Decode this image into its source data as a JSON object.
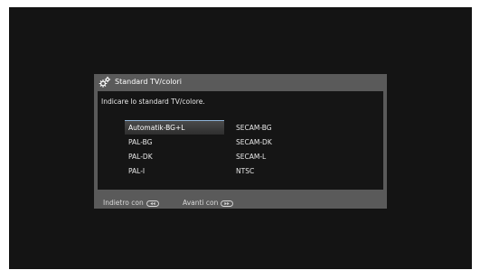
{
  "dialog": {
    "title": "Standard TV/colori",
    "title_icon": "gears-icon",
    "instruction": "Indicare lo standard TV/colore.",
    "options": [
      {
        "label": "Automatik-BG+L",
        "selected": true
      },
      {
        "label": "PAL-BG",
        "selected": false
      },
      {
        "label": "PAL-DK",
        "selected": false
      },
      {
        "label": "PAL-I",
        "selected": false
      },
      {
        "label": "SECAM-BG",
        "selected": false
      },
      {
        "label": "SECAM-DK",
        "selected": false
      },
      {
        "label": "SECAM-L",
        "selected": false
      },
      {
        "label": "NTSC",
        "selected": false
      }
    ],
    "footer": {
      "back_label": "Indietro con",
      "back_icon": "rewind-key-icon",
      "forward_label": "Avanti con",
      "forward_icon": "fast-forward-key-icon"
    }
  },
  "colors": {
    "screen_bg": "#141414",
    "dialog_frame": "#5a5a5a",
    "dialog_body": "#151515",
    "selection_accent": "#8fb4d8",
    "text": "#e9e9e9"
  }
}
